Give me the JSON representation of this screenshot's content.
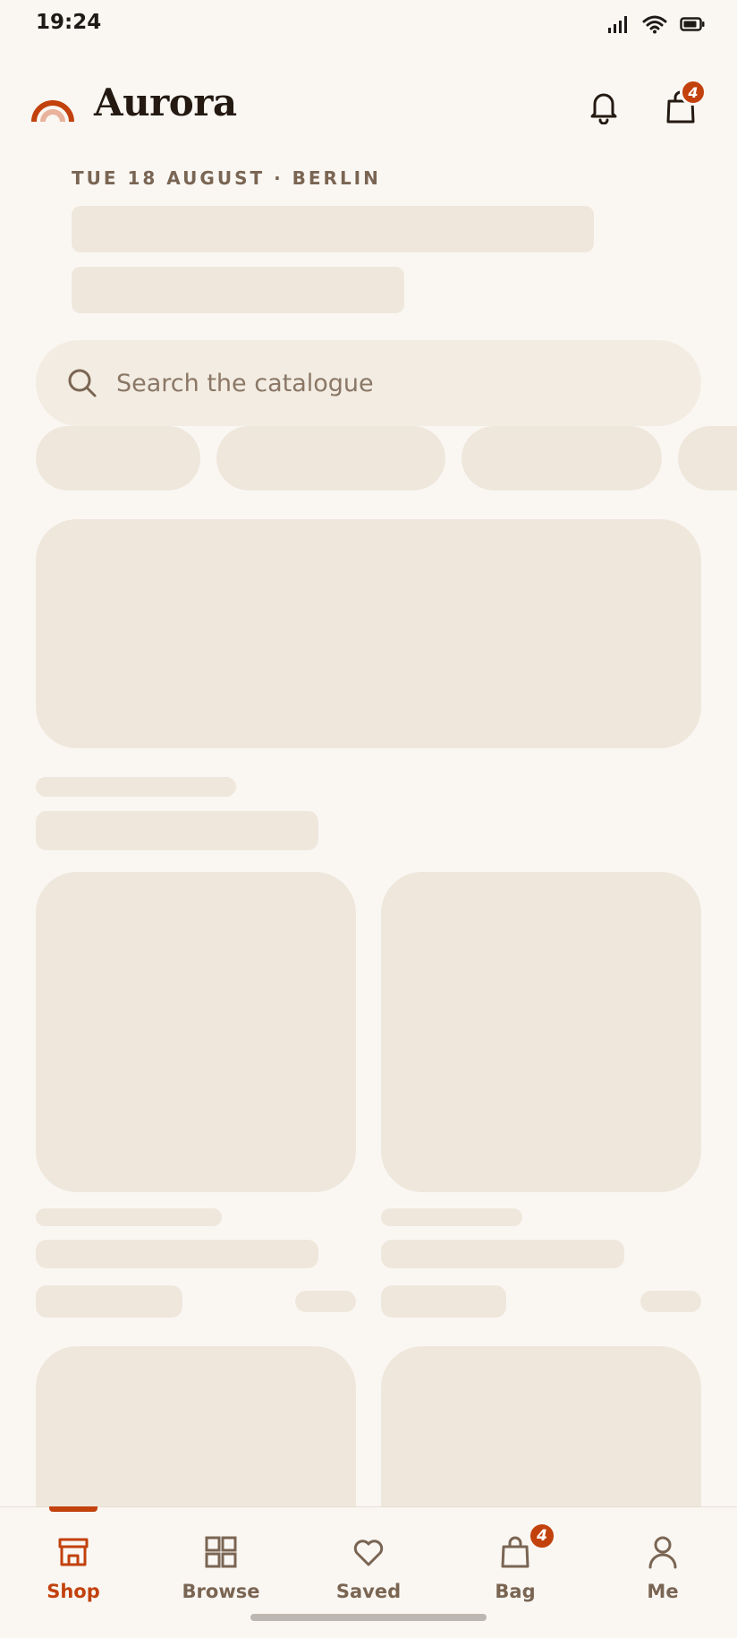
{
  "status_bar": {
    "time": "19:24"
  },
  "header": {
    "brand": "Aurora",
    "bag_count": "4"
  },
  "dateline": "TUE 18 AUGUST · BERLIN",
  "search": {
    "placeholder": "Search the catalogue"
  },
  "colors": {
    "accent": "#C2410C",
    "background": "#FAF7F3",
    "skeleton": "#EFE7DC",
    "muted_text": "#7A6553"
  },
  "bottom_nav": {
    "items": [
      {
        "label": "Shop",
        "icon": "storefront-icon",
        "active": true
      },
      {
        "label": "Browse",
        "icon": "grid-icon",
        "active": false
      },
      {
        "label": "Saved",
        "icon": "heart-icon",
        "active": false
      },
      {
        "label": "Bag",
        "icon": "bag-icon",
        "active": false
      },
      {
        "label": "Me",
        "icon": "person-icon",
        "active": false
      }
    ],
    "bag_badge": "4"
  }
}
